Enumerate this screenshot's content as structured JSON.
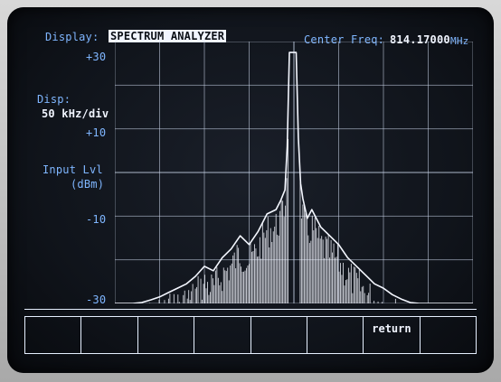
{
  "header": {
    "display_label": "Display:",
    "display_value": "SPECTRUM ANALYZER",
    "center_freq_label": "Center Freq:",
    "center_freq_value": "814.17000",
    "center_freq_unit": "MHz"
  },
  "left_panel": {
    "disp_label": "Disp:",
    "disp_value": "50 kHz/div",
    "input_lvl_label": "Input Lvl",
    "input_lvl_unit": "(dBm)"
  },
  "y_axis": {
    "ticks": [
      "+30",
      "+10",
      "-10",
      "-30"
    ]
  },
  "softkeys": [
    "",
    "",
    "",
    "",
    "",
    "",
    "return",
    ""
  ],
  "colors": {
    "label": "#7fb6ff",
    "trace": "#f4f7ff",
    "grid": "#c8d4e8"
  },
  "chart_data": {
    "type": "line",
    "ylim": [
      -30,
      30
    ],
    "x_divisions": 8,
    "y_divisions": 6,
    "series": [
      {
        "x": [
          -4.0,
          -3.8,
          -3.6,
          -3.4,
          -3.2,
          -3.0,
          -2.8,
          -2.6,
          -2.4,
          -2.2,
          -2.0,
          -1.8,
          -1.6,
          -1.4,
          -1.2,
          -1.0,
          -0.8,
          -0.6,
          -0.4,
          -0.3,
          -0.2,
          -0.15,
          -0.1,
          -0.05,
          0.0,
          0.05,
          0.1,
          0.15,
          0.2,
          0.3,
          0.4,
          0.6,
          0.8,
          1.0,
          1.2,
          1.4,
          1.6,
          1.8,
          2.0,
          2.2,
          2.4,
          2.6,
          2.8,
          3.0,
          3.2,
          3.4,
          3.6,
          3.8,
          4.0
        ],
        "y": [
          -30.0,
          -30.0,
          -30.0,
          -29.8,
          -29.2,
          -28.5,
          -27.5,
          -26.5,
          -25.5,
          -23.8,
          -21.5,
          -22.5,
          -19.5,
          -17.5,
          -14.5,
          -16.5,
          -13.5,
          -9.5,
          -8.5,
          -6.5,
          -4.0,
          6.0,
          27.5,
          27.5,
          27.5,
          27.5,
          8.0,
          -2.5,
          -6.0,
          -10.5,
          -8.5,
          -12.5,
          -14.5,
          -16.5,
          -19.5,
          -21.5,
          -23.5,
          -25.5,
          -26.5,
          -28.0,
          -29.0,
          -29.8,
          -30.0,
          -30.0,
          -30.0,
          -30.0,
          -30.0,
          -30.0,
          -30.0
        ]
      }
    ]
  }
}
